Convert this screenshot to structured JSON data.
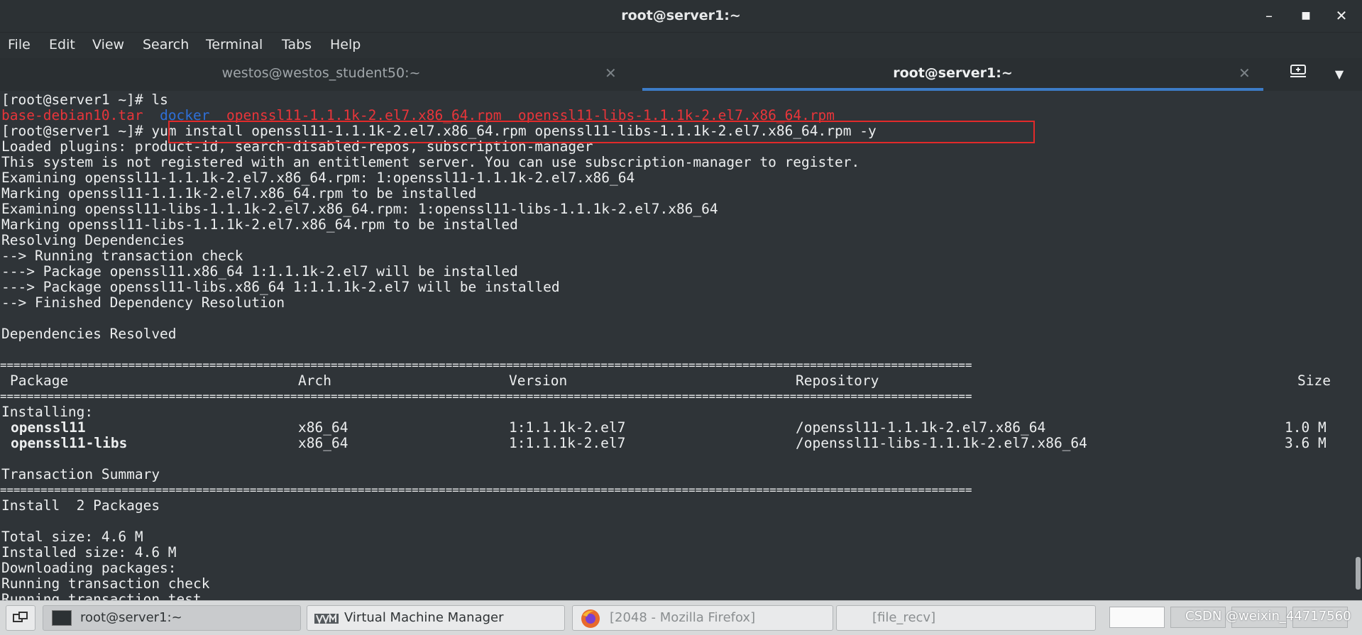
{
  "window": {
    "title": "root@server1:~"
  },
  "menu": [
    "File",
    "Edit",
    "View",
    "Search",
    "Terminal",
    "Tabs",
    "Help"
  ],
  "tabs": [
    {
      "label": "westos@westos_student50:~",
      "active": false
    },
    {
      "label": "root@server1:~",
      "active": true
    }
  ],
  "terminal": {
    "prompt": "[root@server1 ~]# ",
    "cmd1": "ls",
    "ls_output": [
      {
        "name": "base-debian10.tar",
        "color": "#e9353a"
      },
      {
        "name": "docker",
        "color": "#2f6fd8"
      },
      {
        "name": "openssl11-1.1.1k-2.el7.x86_64.rpm",
        "color": "#e9353a"
      },
      {
        "name": "openssl11-libs-1.1.1k-2.el7.x86_64.rpm",
        "color": "#e9353a"
      }
    ],
    "cmd2": "yum install openssl11-1.1.1k-2.el7.x86_64.rpm openssl11-libs-1.1.1k-2.el7.x86_64.rpm -y",
    "lines_a": [
      "Loaded plugins: product-id, search-disabled-repos, subscription-manager",
      "This system is not registered with an entitlement server. You can use subscription-manager to register.",
      "Examining openssl11-1.1.1k-2.el7.x86_64.rpm: 1:openssl11-1.1.1k-2.el7.x86_64",
      "Marking openssl11-1.1.1k-2.el7.x86_64.rpm to be installed",
      "Examining openssl11-libs-1.1.1k-2.el7.x86_64.rpm: 1:openssl11-libs-1.1.1k-2.el7.x86_64",
      "Marking openssl11-libs-1.1.1k-2.el7.x86_64.rpm to be installed",
      "Resolving Dependencies",
      "--> Running transaction check",
      "---> Package openssl11.x86_64 1:1.1.1k-2.el7 will be installed",
      "---> Package openssl11-libs.x86_64 1:1.1.1k-2.el7 will be installed",
      "--> Finished Dependency Resolution",
      "",
      "Dependencies Resolved",
      ""
    ],
    "separator": "================================================================================================================================================",
    "table_headers": {
      "package": "Package",
      "arch": "Arch",
      "version": "Version",
      "repository": "Repository",
      "size": "Size"
    },
    "installing_label": "Installing:",
    "packages": [
      {
        "name": "openssl11",
        "arch": "x86_64",
        "version": "1:1.1.1k-2.el7",
        "repository": "/openssl11-1.1.1k-2.el7.x86_64",
        "size": "1.0 M"
      },
      {
        "name": "openssl11-libs",
        "arch": "x86_64",
        "version": "1:1.1.1k-2.el7",
        "repository": "/openssl11-libs-1.1.1k-2.el7.x86_64",
        "size": "3.6 M"
      }
    ],
    "summary_title": "Transaction Summary",
    "install_count": "Install  2 Packages",
    "lines_b": [
      "Total size: 4.6 M",
      "Installed size: 4.6 M",
      "Downloading packages:",
      "Running transaction check",
      "Running transaction test"
    ]
  },
  "taskbar": {
    "items": [
      {
        "label": "root@server1:~",
        "icon": "terminal-icon",
        "active": true
      },
      {
        "label": "Virtual Machine Manager",
        "icon": "vm-manager-icon",
        "active": false
      },
      {
        "label": "[2048 - Mozilla Firefox]",
        "icon": "firefox-icon",
        "active": false
      },
      {
        "label": "[file_recv]",
        "icon": "",
        "active": false
      }
    ],
    "watermark": "CSDN @weixin_44717560"
  },
  "colors": {
    "background": "#2f3438",
    "highlight_box": "#e22a2a",
    "active_tab_underline": "#3d7cc7"
  }
}
